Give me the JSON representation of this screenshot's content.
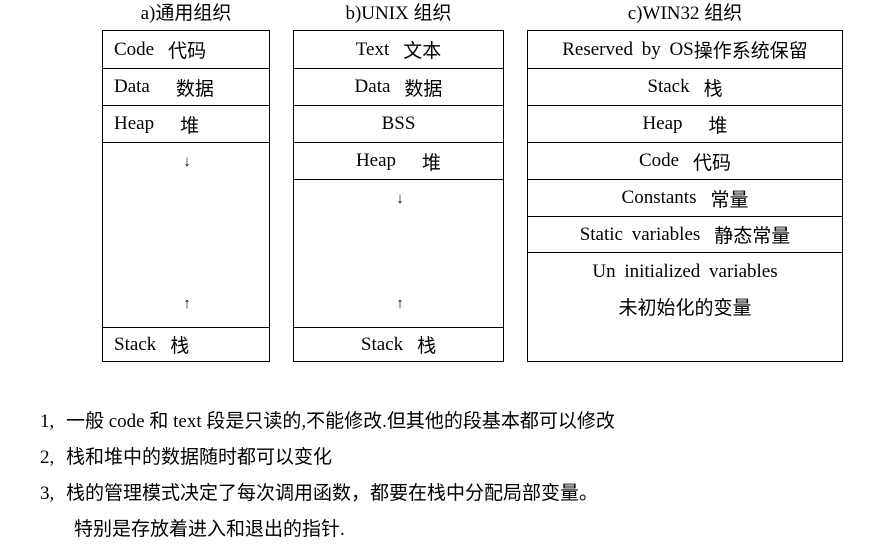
{
  "columns": {
    "general": {
      "title": "a)通用组织",
      "code": {
        "en": "Code",
        "zh": "代码"
      },
      "data": {
        "en": "Data",
        "zh": "数据"
      },
      "heap": {
        "en": "Heap",
        "zh": "堆"
      },
      "down_arrow": "↓",
      "up_arrow": "↑",
      "stack": {
        "en": "Stack",
        "zh": "栈"
      }
    },
    "unix": {
      "title": "b)UNIX 组织",
      "text": {
        "en": "Text",
        "zh": "文本"
      },
      "data": {
        "en": "Data",
        "zh": "数据"
      },
      "bss": "BSS",
      "heap": {
        "en": "Heap",
        "zh": "堆"
      },
      "down_arrow": "↓",
      "up_arrow": "↑",
      "stack": {
        "en": "Stack",
        "zh": "栈"
      }
    },
    "win32": {
      "title": "c)WIN32 组织",
      "reserved": {
        "en": "Reserved by OS",
        "zh": "操作系统保留"
      },
      "stack": {
        "en": "Stack",
        "zh": "栈"
      },
      "heap": {
        "en": "Heap",
        "zh": "堆"
      },
      "code": {
        "en": "Code",
        "zh": "代码"
      },
      "constants": {
        "en": "Constants",
        "zh": "常量"
      },
      "static": {
        "en": "Static variables",
        "zh": "静态常量"
      },
      "uninit": {
        "en": "Un initialized variables",
        "zh": "未初始化的变量"
      }
    }
  },
  "notes": [
    {
      "num": "1,",
      "text": "一般 code 和 text 段是只读的,不能修改.但其他的段基本都可以修改"
    },
    {
      "num": "2,",
      "text": "栈和堆中的数据随时都可以变化"
    },
    {
      "num": "3,",
      "text": "栈的管理模式决定了每次调用函数，都要在栈中分配局部变量。"
    }
  ],
  "note_continuation": "特别是存放着进入和退出的指针."
}
